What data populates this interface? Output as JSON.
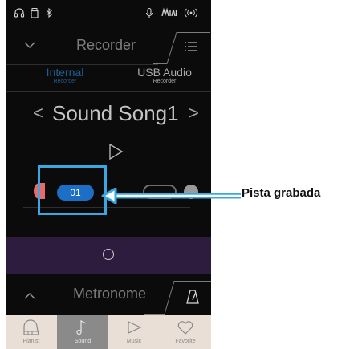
{
  "status_bar": {
    "icons": [
      "headphones-icon",
      "usb-drive-icon",
      "bluetooth-icon",
      "microphone-icon",
      "midi-icon",
      "wireless-icon"
    ]
  },
  "header": {
    "title": "Recorder",
    "left_icon": "chevron-down-icon",
    "right_icon": "menu-icon"
  },
  "source_tabs": [
    {
      "label": "Internal",
      "sublabel": "Recorder",
      "active": true,
      "color": "#1f5f94"
    },
    {
      "label": "USB Audio",
      "sublabel": "Recorder",
      "active": false,
      "color": "#a9a9a9"
    }
  ],
  "song": {
    "prev": "<",
    "title": "Sound Song1",
    "next": ">"
  },
  "transport": {
    "play_icon": "play-icon"
  },
  "tracks": {
    "selected_track": "01",
    "selected_color": "#1c6fc4",
    "record_color": "#e86b6b"
  },
  "record_bar": {
    "icon": "record-circle-icon",
    "color": "#2e1c3e"
  },
  "metronome": {
    "label": "Metronome",
    "left_icon": "chevron-up-icon",
    "right_icon": "metronome-icon"
  },
  "bottom_nav": [
    {
      "label": "Pianist",
      "icon": "piano-icon",
      "active": false
    },
    {
      "label": "Sound",
      "icon": "music-note-icon",
      "active": true
    },
    {
      "label": "Music",
      "icon": "play-outline-icon",
      "active": false
    },
    {
      "label": "Favorite",
      "icon": "heart-icon",
      "active": false
    }
  ],
  "callout": {
    "text": "Pista grabada",
    "color": "#3aa7e0"
  }
}
